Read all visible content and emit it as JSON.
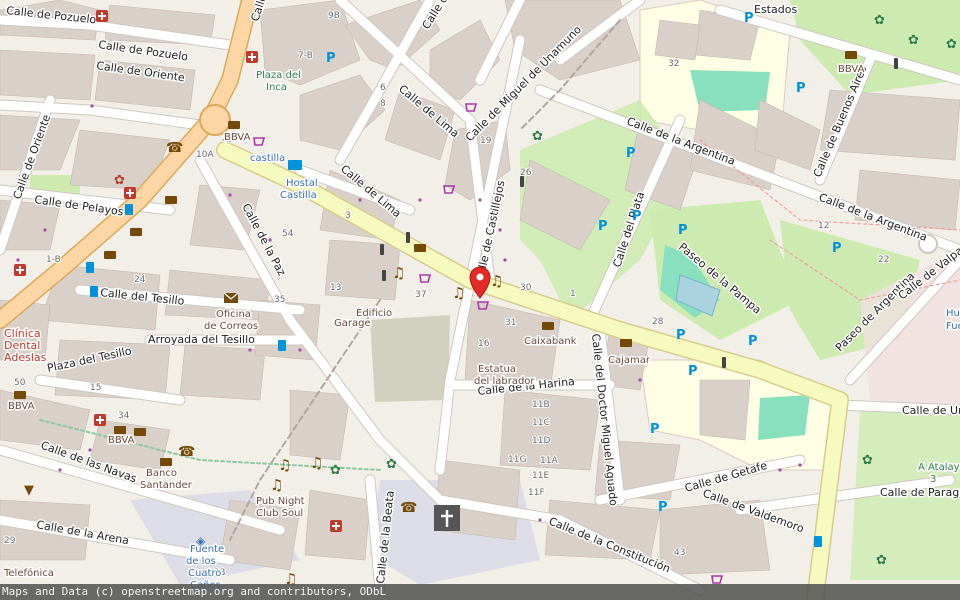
{
  "streets": {
    "pozuelo_top": "Calle de Pozuelo",
    "pozuelo": "Calle de Pozuelo",
    "oriente_h": "Calle de Oriente",
    "oriente_v": "Calle de Oriente",
    "pelayos": "Calle de Pelayos",
    "tesillo": "Calle del Tesillo",
    "arroyada": "Arroyada del Tesillo",
    "plaza_tesillo": "Plaza del Tesillo",
    "navas": "Calle de las Navas",
    "arena": "Calle de la Arena",
    "paz": "Calle de la Paz",
    "lima_upper": "Calle de Lima",
    "lima_lower": "Calle de Lima",
    "castillejos": "Calle de Castillejos",
    "unamuno": "Calle de Miguel de Unamuno",
    "argentina_1": "Calle de la Argentina",
    "argentina_2": "Calle de la Argentina",
    "buenos_aires": "Calle de Buenos Aires",
    "plata": "Calle del Plata",
    "paseo_pampa": "Paseo de la Pampa",
    "paseo_argentina": "Paseo de Argentina",
    "valparaiso": "Calle de Valpara",
    "doctor_miguel": "Calle del Doctor Miguel Aguado",
    "harina": "Calle de la Harina",
    "getafe": "Calle de Getafe",
    "valdemoro": "Calle de Valdemoro",
    "constitucion": "Calle de la Constitución",
    "beata": "Calle de la Beata",
    "uru": "Calle de Uru",
    "paragua": "Calle de Paragua",
    "estados": "Estados",
    "hue": "Hue",
    "fue": "Fue",
    "top_calle": "Calle",
    "lo_calle": "Calle de Lo"
  },
  "places": {
    "plaza_inca_1": "Plaza del",
    "plaza_inca_2": "Inca",
    "castilla": "castilla",
    "hostal_1": "Hostal",
    "hostal_2": "Castilla",
    "bbva_1": "BBVA",
    "bbva_2": "BBVA",
    "bbva_3": "BBVA",
    "bbva_4": "BBVA",
    "oficina_1": "Oficina",
    "oficina_2": "de Correos",
    "edificio": "Edificio",
    "garage": "Garage",
    "caixabank": "Caixabank",
    "cajamar": "Cajamar",
    "estatua_1": "Estatua",
    "estatua_2": "del labrador",
    "clinica_1": "Clínica",
    "clinica_2": "Dental",
    "clinica_3": "Adeslas",
    "banco_1": "Banco",
    "banco_2": "Santander",
    "pub_1": "Pub Night",
    "pub_2": "Club Soul",
    "fuente_1": "Fuente",
    "fuente_2": "de los",
    "fuente_3": "Cuatro",
    "fuente_4": "Caños",
    "telefonica": "Telefónica",
    "atalaya_1": "A Atalay",
    "atalaya_2": "3"
  },
  "house_numbers": {
    "n1": "9B",
    "n2": "32",
    "n3": "49",
    "n4": "10A",
    "n5": "54",
    "n6": "35",
    "n7": "37",
    "n8": "31",
    "n9": "28",
    "n10": "11B",
    "n11": "11C",
    "n12": "11D",
    "n13": "11E",
    "n14": "11F",
    "n15": "11G",
    "n16": "11A",
    "n17": "15",
    "n18": "34",
    "n19": "22",
    "n20": "43",
    "n21": "7-B",
    "n22": "26",
    "n23": "30",
    "n24": "24",
    "n25": "50",
    "n26": "29",
    "n27": "13",
    "n28": "16",
    "n29": "19",
    "n30": "1-B",
    "n31": "12",
    "n32": "33",
    "n33": "6",
    "n34": "8",
    "n35": "3",
    "n36": "1"
  },
  "attribution": "Maps and Data (c) openstreetmap.org and contributors, ODbL",
  "colors": {
    "background": "#f2efe9",
    "building": "#d9d0c9",
    "primary_road": "#fcd6a4",
    "secondary_road": "#f7fabf",
    "park": "#cdebb0",
    "school": "#ffffe5",
    "pitch": "#88e0be",
    "pedestrian": "#dddde8",
    "marker": "#e52828"
  },
  "icons": [
    "map-marker-icon",
    "parking-icon",
    "bank-icon",
    "pharmacy-icon",
    "post-office-icon",
    "music-icon",
    "shop-icon",
    "church-icon",
    "hotel-icon",
    "bus-stop-icon",
    "playground-icon",
    "traffic-signal-icon",
    "dentist-icon",
    "fountain-icon"
  ]
}
